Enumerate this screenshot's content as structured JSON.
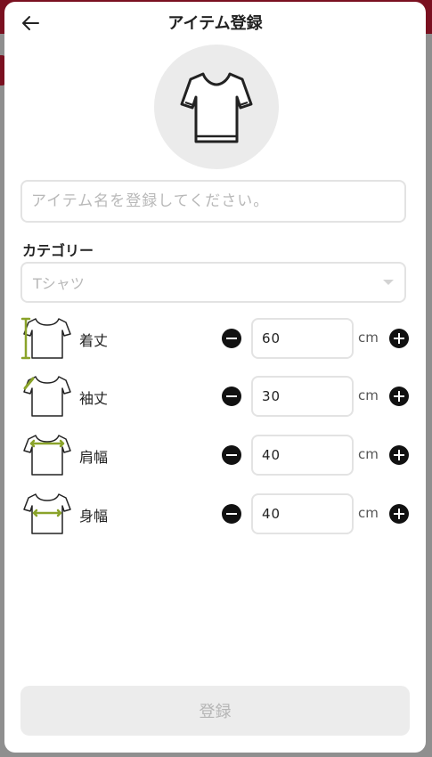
{
  "header": {
    "title": "アイテム登録"
  },
  "item_name": {
    "placeholder": "アイテム名を登録してください。",
    "value": ""
  },
  "category": {
    "label": "カテゴリー",
    "selected": "Tシャツ"
  },
  "measurements": [
    {
      "label": "着丈",
      "value": "60",
      "unit": "cm",
      "icon": "tshirt-length-icon"
    },
    {
      "label": "袖丈",
      "value": "30",
      "unit": "cm",
      "icon": "tshirt-sleeve-icon"
    },
    {
      "label": "肩幅",
      "value": "40",
      "unit": "cm",
      "icon": "tshirt-shoulder-icon"
    },
    {
      "label": "身幅",
      "value": "40",
      "unit": "cm",
      "icon": "tshirt-width-icon"
    }
  ],
  "submit": {
    "label": "登録"
  },
  "colors": {
    "accent": "#7a1020",
    "highlight": "#8aa32a"
  }
}
